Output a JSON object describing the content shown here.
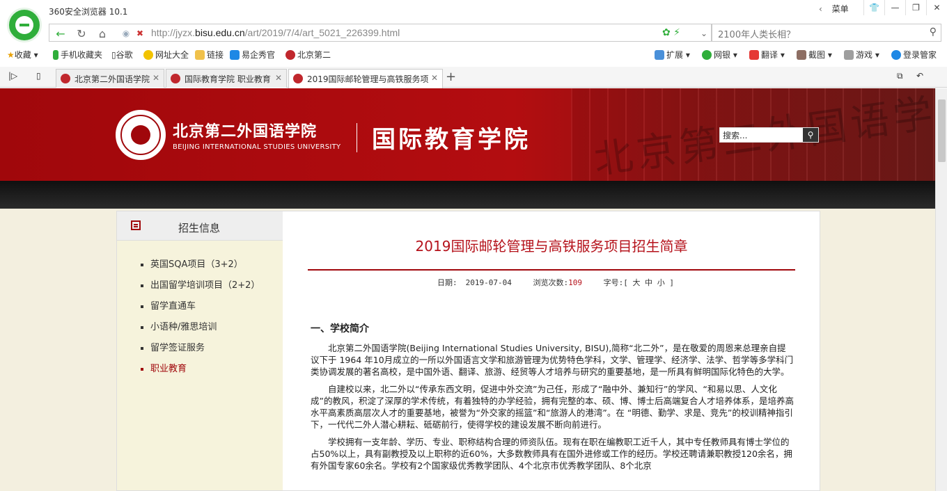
{
  "browser": {
    "app_title": "360安全浏览器 10.1",
    "menu_label": "菜单",
    "url_prefix": "http://jyzx.",
    "url_domain": "bisu.edu.cn",
    "url_path": "/art/2019/7/4/art_5021_226399.html",
    "search_placeholder": "2100年人类长相？",
    "favorites": {
      "collect": "收藏",
      "mobile_favorites": "手机收藏夹",
      "google": "谷歌",
      "site_directory": "网址大全",
      "links": "链接",
      "yiqixiu": "易企秀官",
      "bisu": "北京第二"
    },
    "toolbar_right": {
      "extensions": "扩展",
      "netbank": "网银",
      "translate": "翻译",
      "screenshot": "截图",
      "games": "游戏",
      "login": "登录管家"
    },
    "tabs": [
      {
        "label": "北京第二外国语学院",
        "active": false
      },
      {
        "label": "国际教育学院 职业教育",
        "active": false
      },
      {
        "label": "2019国际邮轮管理与高铁服务项",
        "active": true
      }
    ]
  },
  "site": {
    "school_name_cn": "北京第二外国语学院",
    "school_name_en": "BEIJING INTERNATIONAL STUDIES UNIVERSITY",
    "college_name": "国际教育学院",
    "search_placeholder": "搜索...",
    "banner_overlay": "北京第二外国语学院"
  },
  "sidebar": {
    "title": "招生信息",
    "items": [
      {
        "label": "英国SQA项目（3+2）",
        "active": false
      },
      {
        "label": "出国留学培训项目（2+2）",
        "active": false
      },
      {
        "label": "留学直通车",
        "active": false
      },
      {
        "label": "小语种/雅思培训",
        "active": false
      },
      {
        "label": "留学签证服务",
        "active": false
      },
      {
        "label": "职业教育",
        "active": true
      }
    ]
  },
  "article": {
    "title": "2019国际邮轮管理与高铁服务项目招生简章",
    "date_label": "日期:",
    "date": "2019-07-04",
    "views_label": "浏览次数:",
    "views": "109",
    "fontsize_label": "字号:",
    "fontsize_options": "[ 大 中 小 ]",
    "section_heading": "一、学校简介",
    "paragraphs": [
      "北京第二外国语学院(Beijing International Studies University, BISU),简称“北二外”，是在敬爱的周恩来总理亲自提议下于 1964 年10月成立的一所以外国语言文学和旅游管理为优势特色学科，文学、管理学、经济学、法学、哲学等多学科门类协调发展的著名高校，是中国外语、翻译、旅游、经贸等人才培养与研究的重要基地，是一所具有鲜明国际化特色的大学。",
      "自建校以来，北二外以“传承东西文明，促进中外交流”为己任，形成了“融中外、兼知行”的学风、“和易以思、人文化成”的教风，积淀了深厚的学术传统，有着独特的办学经验，拥有完整的本、硕、博、博士后高端复合人才培养体系，是培养高水平高素质高层次人才的重要基地，被誉为“外交家的摇篮”和“旅游人的港湾”。在 “明德、勤学、求是、竞先”的校训精神指引下，一代代二外人潜心耕耘、砥砺前行，使得学校的建设发展不断向前进行。",
      "学校拥有一支年龄、学历、专业、职称结构合理的师资队伍。现有在职在编教职工近千人，其中专任教师具有博士学位的占50%以上，具有副教授及以上职称的近60%，大多数教师具有在国外进修或工作的经历。学校还聘请兼职教授120余名，拥有外国专家60余名。学校有2个国家级优秀教学团队、4个北京市优秀教学团队、8个北京"
    ]
  }
}
